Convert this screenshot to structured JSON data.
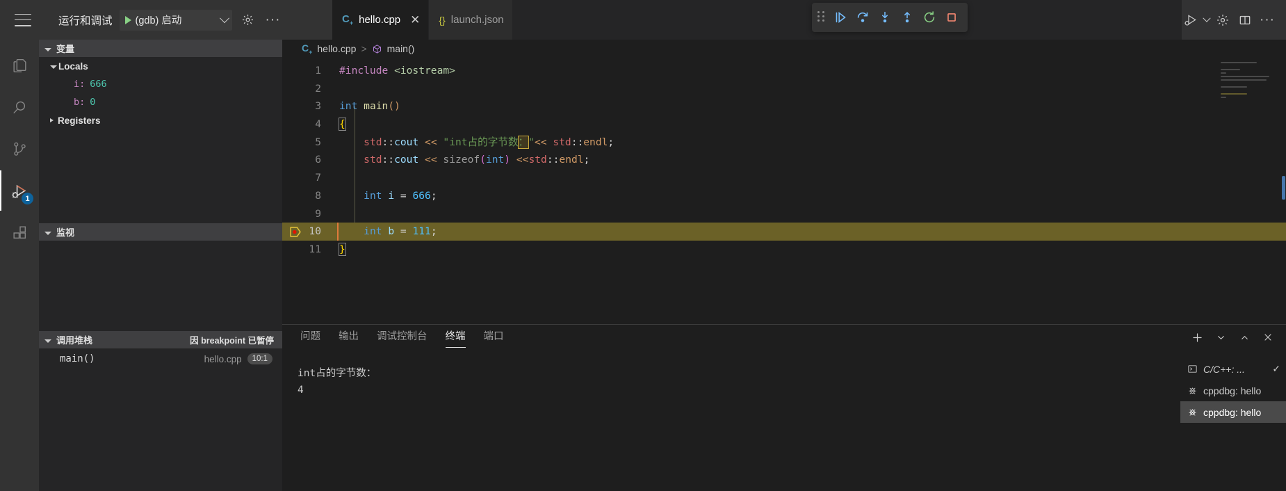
{
  "window": {
    "theme_bg": "#1e1e1e",
    "accent": "#0e639c"
  },
  "topbar": {
    "menu_icon": "hamburger-icon",
    "debug_title": "运行和调试",
    "launch_config": "(gdb) 启动",
    "settings_icon": "gear-icon",
    "more_icon": "ellipsis-icon"
  },
  "tabs": [
    {
      "label": "hello.cpp",
      "icon": "cpp-file-icon",
      "active": true,
      "closable": true
    },
    {
      "label": "launch.json",
      "icon": "json-file-icon",
      "active": false,
      "closable": false
    }
  ],
  "debug_toolbar": {
    "buttons": [
      {
        "name": "drag-handle",
        "title": "拖动"
      },
      {
        "name": "continue-button",
        "title": "继续"
      },
      {
        "name": "step-over-button",
        "title": "单步跳过"
      },
      {
        "name": "step-into-button",
        "title": "单步调试"
      },
      {
        "name": "step-out-button",
        "title": "单步跳出"
      },
      {
        "name": "restart-button",
        "title": "重启",
        "color": "#89d185"
      },
      {
        "name": "stop-button",
        "title": "停止",
        "color": "#f48771"
      }
    ]
  },
  "topright": {
    "run_debug_icon": "run-and-debug-icon",
    "settings_icon": "gear-icon",
    "layout_icon": "split-editor-icon",
    "more_icon": "ellipsis-icon"
  },
  "activitybar": {
    "items": [
      {
        "name": "explorer",
        "icon": "files-icon",
        "active": false
      },
      {
        "name": "search",
        "icon": "search-icon",
        "active": false
      },
      {
        "name": "source-control",
        "icon": "source-control-icon",
        "active": false
      },
      {
        "name": "run-and-debug",
        "icon": "run-debug-icon",
        "active": true,
        "badge": "1"
      },
      {
        "name": "extensions",
        "icon": "extensions-icon",
        "active": false
      }
    ]
  },
  "sidebar": {
    "variables": {
      "title": "变量",
      "groups": [
        {
          "label": "Locals",
          "expanded": true,
          "items": [
            {
              "name": "i",
              "value": "666"
            },
            {
              "name": "b",
              "value": "0"
            }
          ]
        },
        {
          "label": "Registers",
          "expanded": false,
          "items": []
        }
      ]
    },
    "watch": {
      "title": "监视",
      "items": []
    },
    "callstack": {
      "title": "调用堆栈",
      "status": "因 breakpoint 已暂停",
      "frames": [
        {
          "function": "main()",
          "file": "hello.cpp",
          "position": "10:1"
        }
      ]
    }
  },
  "breadcrumb": {
    "file": "hello.cpp",
    "separator": ">",
    "symbol": "main()",
    "file_icon": "cpp-file-icon",
    "symbol_icon": "symbol-method-icon"
  },
  "editor": {
    "filename": "hello.cpp",
    "current_line": 10,
    "breakpoint_lines": [
      10
    ],
    "selection_text": "：",
    "lines": [
      {
        "n": 1,
        "tokens": [
          {
            "t": "#include ",
            "c": "k-inc"
          },
          {
            "t": "<iostream>",
            "c": "k-strlit"
          }
        ]
      },
      {
        "n": 2,
        "tokens": []
      },
      {
        "n": 3,
        "tokens": [
          {
            "t": "int ",
            "c": "k-type"
          },
          {
            "t": "main",
            "c": "k-fn"
          },
          {
            "t": "(",
            "c": "k-orange"
          },
          {
            "t": ")",
            "c": "k-orange"
          }
        ]
      },
      {
        "n": 4,
        "tokens": [
          {
            "t": "{",
            "c": "k-brk"
          }
        ]
      },
      {
        "n": 5,
        "tokens": [
          {
            "t": "    ",
            "c": ""
          },
          {
            "t": "std",
            "c": "k-ns"
          },
          {
            "t": "::",
            "c": "k-punc"
          },
          {
            "t": "cout",
            "c": "k-var"
          },
          {
            "t": " ",
            "c": ""
          },
          {
            "t": "<<",
            "c": "k-orange"
          },
          {
            "t": " ",
            "c": ""
          },
          {
            "t": "\"int占的字节数",
            "c": "k-green"
          },
          {
            "t": "：",
            "c": "sel"
          },
          {
            "t": "\"",
            "c": "k-green"
          },
          {
            "t": "<<",
            "c": "k-orange"
          },
          {
            "t": " ",
            "c": ""
          },
          {
            "t": "std",
            "c": "k-ns"
          },
          {
            "t": "::",
            "c": "k-punc"
          },
          {
            "t": "endl",
            "c": "k-orange"
          },
          {
            "t": ";",
            "c": "k-punc"
          }
        ]
      },
      {
        "n": 6,
        "tokens": [
          {
            "t": "    ",
            "c": ""
          },
          {
            "t": "std",
            "c": "k-ns"
          },
          {
            "t": "::",
            "c": "k-punc"
          },
          {
            "t": "cout",
            "c": "k-var"
          },
          {
            "t": " ",
            "c": ""
          },
          {
            "t": "<<",
            "c": "k-orange"
          },
          {
            "t": " ",
            "c": ""
          },
          {
            "t": "sizeof",
            "c": "k-gray"
          },
          {
            "t": "(",
            "c": "k-brk2"
          },
          {
            "t": "int",
            "c": "k-type"
          },
          {
            "t": ")",
            "c": "k-brk2"
          },
          {
            "t": " ",
            "c": ""
          },
          {
            "t": "<<",
            "c": "k-orange"
          },
          {
            "t": "std",
            "c": "k-ns"
          },
          {
            "t": "::",
            "c": "k-punc"
          },
          {
            "t": "endl",
            "c": "k-orange"
          },
          {
            "t": ";",
            "c": "k-punc"
          }
        ]
      },
      {
        "n": 7,
        "tokens": []
      },
      {
        "n": 8,
        "tokens": [
          {
            "t": "    ",
            "c": ""
          },
          {
            "t": "int",
            "c": "k-type"
          },
          {
            "t": " ",
            "c": ""
          },
          {
            "t": "i",
            "c": "k-var"
          },
          {
            "t": " = ",
            "c": "k-punc"
          },
          {
            "t": "666",
            "c": "k-numc"
          },
          {
            "t": ";",
            "c": "k-punc"
          }
        ]
      },
      {
        "n": 9,
        "tokens": []
      },
      {
        "n": 10,
        "tokens": [
          {
            "t": "    ",
            "c": ""
          },
          {
            "t": "int",
            "c": "k-type"
          },
          {
            "t": " ",
            "c": ""
          },
          {
            "t": "b",
            "c": "k-var"
          },
          {
            "t": " = ",
            "c": "k-punc"
          },
          {
            "t": "111",
            "c": "k-numc"
          },
          {
            "t": ";",
            "c": "k-punc"
          }
        ]
      },
      {
        "n": 11,
        "tokens": [
          {
            "t": "}",
            "c": "k-brk"
          }
        ]
      }
    ]
  },
  "panel": {
    "tabs": [
      {
        "label": "问题",
        "active": false
      },
      {
        "label": "输出",
        "active": false
      },
      {
        "label": "调试控制台",
        "active": false
      },
      {
        "label": "终端",
        "active": true
      },
      {
        "label": "端口",
        "active": false
      }
    ],
    "actions": [
      {
        "name": "new-terminal-button",
        "icon": "plus-icon"
      },
      {
        "name": "terminal-dropdown-button",
        "icon": "chevron-down-icon"
      },
      {
        "name": "maximize-panel-button",
        "icon": "chevron-up-icon"
      },
      {
        "name": "close-panel-button",
        "icon": "close-icon"
      }
    ],
    "terminal_output": "int占的字节数：\n4",
    "terminal_list": [
      {
        "label": "C/C++: ...",
        "icon": "terminal-icon",
        "selected": false,
        "check": "✓"
      },
      {
        "label": "cppdbg: hello",
        "icon": "debug-icon",
        "selected": false,
        "check": ""
      },
      {
        "label": "cppdbg: hello",
        "icon": "debug-icon",
        "selected": true,
        "check": ""
      }
    ]
  }
}
